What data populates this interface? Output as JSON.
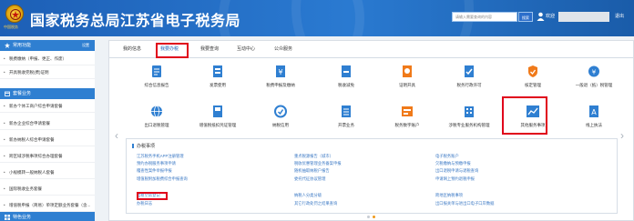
{
  "header": {
    "title": "国家税务总局江苏省电子税务局",
    "emblem_caption": "中国税务",
    "search_placeholder": "请输入需要查询的内容",
    "search_button": "搜索",
    "welcome": "欢迎",
    "logout": "退出"
  },
  "sidebar": {
    "section1": {
      "title": "常用功能",
      "more": "设置"
    },
    "common_items": [
      "税费缴纳（申报、更正、作废）",
      "开具税收完税(费)证明"
    ],
    "section2": {
      "title": "套餐业务"
    },
    "package_items": [
      "新办个体工商户综合申请套餐",
      "新办企业综合申请套餐",
      "新办纳税人综合申请套餐",
      "跨区域涉税事项综合办理套餐",
      "小规模转一般纳税人套餐",
      "国际税收业务套餐",
      "增值税申报（简易）单项定额业务套餐（含..."
    ],
    "section3": {
      "title": "特色业务"
    }
  },
  "tabs": [
    "我的信息",
    "我要办税",
    "我要查询",
    "互动中心",
    "公众服务"
  ],
  "active_tab": "我要办税",
  "icons_row1": [
    "综合信息报告",
    "发票使用",
    "税费申报及缴纳",
    "税收减免",
    "证明开具",
    "税务行政许可",
    "核定管理",
    "一般退（抵）税管理"
  ],
  "icons_row2": [
    "出口退税管理",
    "增值税抵扣凭证管理",
    "纳税信用",
    "开票业务",
    "税务数字账户",
    "涉税专业服务机构管理",
    "其他服务事项",
    "线上执法"
  ],
  "colors": {
    "accent": "#2f7fd1",
    "highlight": "#e0001b",
    "link": "#3a78c4"
  },
  "sub_panel": {
    "title": "办税事项",
    "columns": [
      [
        "江苏税务手机APP注册管理",
        "预约办税服务事项申请",
        "稽查性案件举报申报",
        "增值税附加税费综合申报查询",
        "出租空房登记",
        "办税日志"
      ],
      [
        "重点税源报告（城市）",
        "税收优惠管理业务备案申报",
        "随机抽取纳税户报告",
        "委托代征协议管理",
        "纳税人分类分级",
        "其它行政处罚之结果查询"
      ],
      [
        "电子税务账户",
        "欠税缴纳与预缴申报",
        "出口退税申请与退税查询",
        "申请网上预约退税申报",
        "跨地区纳税事项",
        "出口报关单与进出口电子口岸数据"
      ]
    ]
  }
}
